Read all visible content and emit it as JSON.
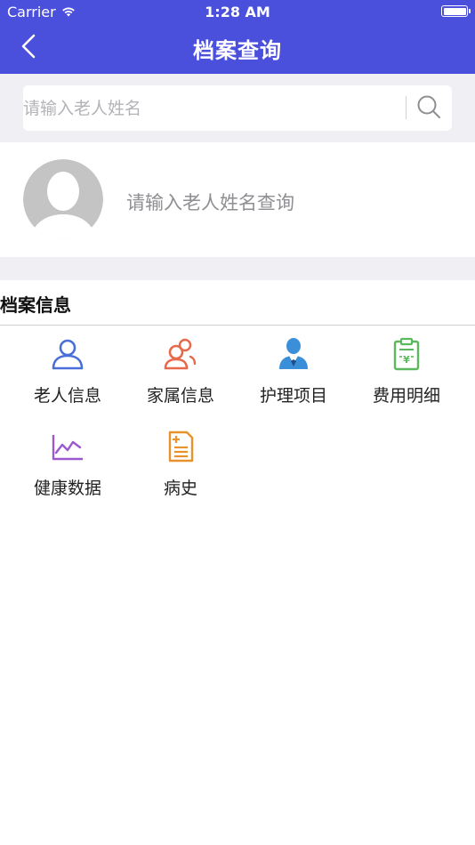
{
  "status_bar": {
    "carrier": "Carrier",
    "time": "1:28 AM"
  },
  "nav": {
    "title": "档案查询",
    "back_icon": "chevron-left-icon"
  },
  "search": {
    "placeholder": "请输入老人姓名",
    "icon": "search-icon"
  },
  "profile": {
    "prompt": "请输入老人姓名查询",
    "avatar_icon": "default-avatar-icon"
  },
  "section": {
    "title": "档案信息"
  },
  "grid_items": [
    {
      "label": "老人信息",
      "icon": "person-icon",
      "color": "#4a6fd8"
    },
    {
      "label": "家属信息",
      "icon": "family-icon",
      "color": "#e8684a"
    },
    {
      "label": "护理项目",
      "icon": "caregiver-icon",
      "color": "#3a8fd8"
    },
    {
      "label": "费用明细",
      "icon": "fee-clipboard-icon",
      "color": "#5cb85c"
    },
    {
      "label": "健康数据",
      "icon": "line-chart-icon",
      "color": "#9b59d0"
    },
    {
      "label": "病史",
      "icon": "medical-record-icon",
      "color": "#e8922e"
    }
  ],
  "colors": {
    "header_bg": "#4a4fdc",
    "page_bg": "#efeff4"
  }
}
